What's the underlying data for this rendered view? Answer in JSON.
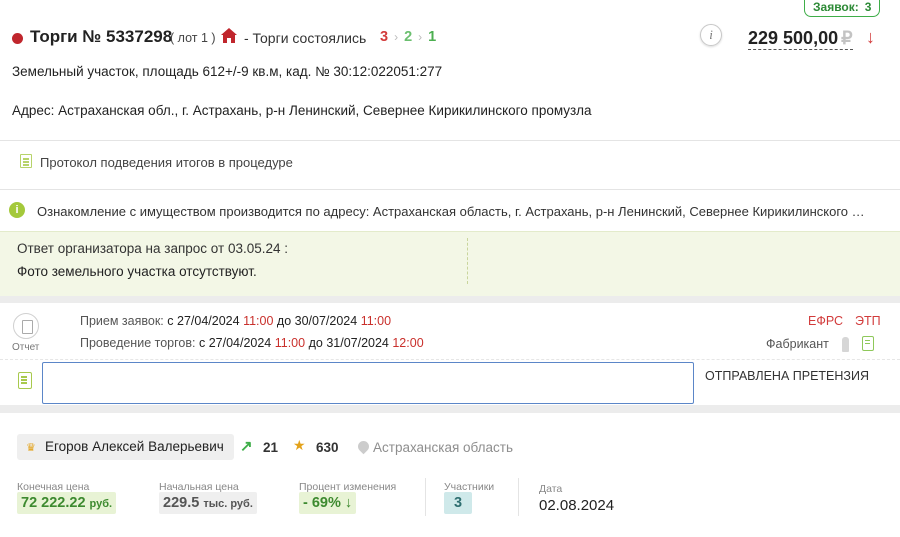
{
  "header": {
    "bids_label": "Заявок:",
    "bids_count": "3",
    "title": "Торги № 5337298",
    "lot": "( лот 1 )",
    "status": "- Торги состоялись",
    "steps": [
      "3",
      "2",
      "1"
    ],
    "price": "229 500,00",
    "currency": "₽",
    "info_glyph": "i"
  },
  "lot_info": {
    "description": "Земельный участок, площадь 612+/-9 кв.м, кад. № 30:12:022051:277",
    "address": "Адрес: Астраханская обл., г. Астрахань, р-н Ленинский, Севернее Кирикилинского промузла",
    "protocol_link": "Протокол подведения итогов в процедуре",
    "notice": "Ознакомление с имуществом производится по адресу: Астраханская область, г. Астрахань, р-н Ленинский, Севернее Кирикилинского …"
  },
  "organizer_answer": {
    "header": "Ответ организатора на запрос от 03.05.24 :",
    "text": "Фото земельного участка отсутствуют."
  },
  "schedule": {
    "report_label": "Отчет",
    "applications": {
      "label": "Прием заявок:",
      "from_label": "с",
      "from_date": "27/04/2024",
      "from_time": "11:00",
      "to_label": "до",
      "to_date": "30/07/2024",
      "to_time": "11:00"
    },
    "bidding": {
      "label": "Проведение торгов:",
      "from_label": "с",
      "from_date": "27/04/2024",
      "from_time": "11:00",
      "to_label": "до",
      "to_date": "31/07/2024",
      "to_time": "12:00"
    },
    "efrs": "ЕФРС",
    "etp": "ЭТП",
    "platform": "Фабрикант"
  },
  "comment": {
    "value": "",
    "claim_status": "ОТПРАВЛЕНА ПРЕТЕНЗИЯ"
  },
  "winner": {
    "name": "Егоров Алексей Валерьевич",
    "trend_value": "21",
    "trophy_value": "630",
    "region": "Астраханская область"
  },
  "stats": {
    "final_price_label": "Конечная цена",
    "final_price": "72 222.22",
    "final_price_unit": "руб.",
    "start_price_label": "Начальная цена",
    "start_price": "229.5",
    "start_price_unit": "тыс. руб.",
    "change_label": "Процент изменения",
    "change_value": "- 69%",
    "participants_label": "Участники",
    "participants_value": "3",
    "date_label": "Дата",
    "date_value": "02.08.2024"
  },
  "colors": {
    "accent_green": "#3fae49",
    "accent_red": "#d23b3b",
    "answer_bg": "#f3f7e6",
    "input_border": "#5b86c8"
  },
  "icons": [
    "house-icon",
    "info-icon",
    "arrow-down-icon",
    "document-icon",
    "info-green-icon",
    "report-icon",
    "bottle-icon",
    "note-icon",
    "edit-icon",
    "crown-icon",
    "trend-icon",
    "trophy-icon",
    "pin-icon"
  ]
}
